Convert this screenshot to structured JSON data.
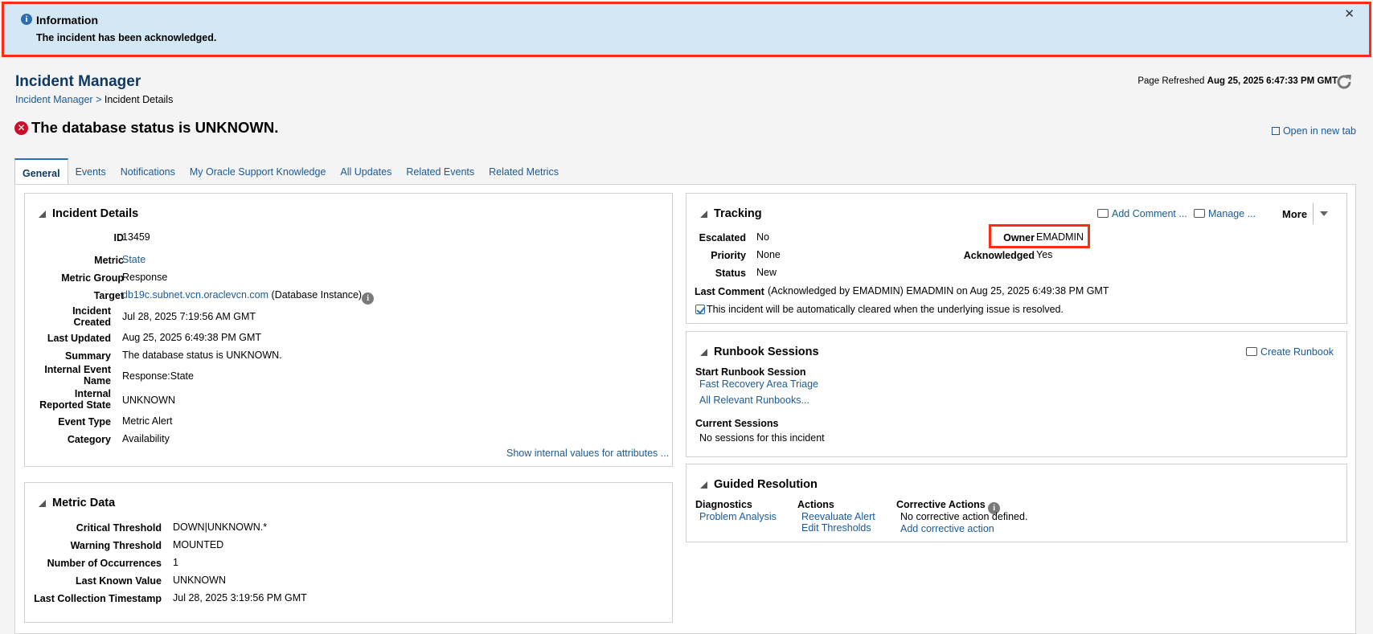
{
  "banner": {
    "title": "Information",
    "message": "The incident has been acknowledged.",
    "close": "✕"
  },
  "header": {
    "title": "Incident Manager",
    "breadcrumb_link": "Incident Manager",
    "breadcrumb_sep": ">",
    "breadcrumb_current": "Incident Details",
    "refresh_label": "Page Refreshed",
    "refresh_time": "Aug 25, 2025 6:47:33 PM GMT",
    "heading": "The database status is UNKNOWN.",
    "open_new_tab": "Open in new tab"
  },
  "tabs": [
    {
      "label": "General"
    },
    {
      "label": "Events"
    },
    {
      "label": "Notifications"
    },
    {
      "label": "My Oracle Support Knowledge"
    },
    {
      "label": "All Updates"
    },
    {
      "label": "Related Events"
    },
    {
      "label": "Related Metrics"
    }
  ],
  "incident_details": {
    "title": "Incident Details",
    "id_label": "ID",
    "id": "13459",
    "metric_label": "Metric",
    "metric": "State",
    "metric_group_label": "Metric Group",
    "metric_group": "Response",
    "target_label": "Target",
    "target": "db19c.subnet.vcn.oraclevcn.com",
    "target_type": "(Database Instance)",
    "created_label_1": "Incident",
    "created_label_2": "Created",
    "created": "Jul 28, 2025 7:19:56 AM GMT",
    "updated_label": "Last Updated",
    "updated": "Aug 25, 2025 6:49:38 PM GMT",
    "summary_label": "Summary",
    "summary": "The database status is UNKNOWN.",
    "event_name_label_1": "Internal Event",
    "event_name_label_2": "Name",
    "event_name": "Response:State",
    "reported_state_label_1": "Internal",
    "reported_state_label_2": "Reported State",
    "reported_state": "UNKNOWN",
    "event_type_label": "Event Type",
    "event_type": "Metric Alert",
    "category_label": "Category",
    "category": "Availability",
    "show_internal": "Show internal values for attributes ..."
  },
  "metric_data": {
    "title": "Metric Data",
    "critical_label": "Critical Threshold",
    "critical": "DOWN|UNKNOWN.*",
    "warning_label": "Warning Threshold",
    "warning": "MOUNTED",
    "occurrences_label": "Number of Occurrences",
    "occurrences": "1",
    "last_value_label": "Last Known Value",
    "last_value": "UNKNOWN",
    "last_collection_label": "Last Collection Timestamp",
    "last_collection": "Jul 28, 2025 3:19:56 PM GMT"
  },
  "tracking": {
    "title": "Tracking",
    "add_comment": "Add Comment ...",
    "manage": "Manage ...",
    "more": "More",
    "escalated_label": "Escalated",
    "escalated": "No",
    "priority_label": "Priority",
    "priority": "None",
    "status_label": "Status",
    "status": "New",
    "owner_label": "Owner",
    "owner": "EMADMIN",
    "acknowledged_label": "Acknowledged",
    "acknowledged": "Yes",
    "last_comment_label": "Last Comment",
    "last_comment": "(Acknowledged by EMADMIN) EMADMIN on Aug 25, 2025 6:49:38 PM GMT",
    "auto_clear": "This incident will be automatically cleared when the underlying issue is resolved."
  },
  "runbook": {
    "title": "Runbook Sessions",
    "create": "Create Runbook",
    "start_label": "Start Runbook Session",
    "fast_recovery": "Fast Recovery Area Triage",
    "all_relevant": "All Relevant Runbooks...",
    "current_label": "Current Sessions",
    "no_sessions": "No sessions for this incident"
  },
  "guided": {
    "title": "Guided Resolution",
    "diagnostics_label": "Diagnostics",
    "problem_analysis": "Problem Analysis",
    "actions_label": "Actions",
    "reevaluate": "Reevaluate Alert",
    "edit_thresholds": "Edit Thresholds",
    "corrective_label": "Corrective Actions",
    "no_corrective": "No corrective action defined.",
    "add_corrective": "Add corrective action"
  }
}
